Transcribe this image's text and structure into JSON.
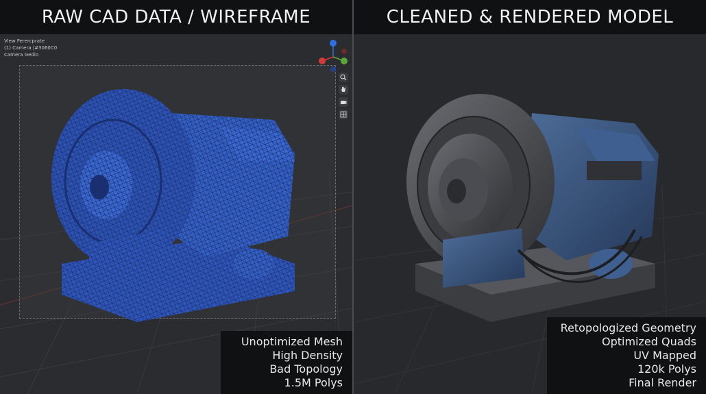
{
  "left_panel": {
    "title": "RAW CAD DATA / WIREFRAME",
    "viewport_info": [
      "View Ferercprate",
      "(1) Camera |#3060C0",
      "Camera Gedio"
    ],
    "caption": [
      "Unoptimized Mesh",
      "High Density",
      "Bad Topology",
      "1.5M Polys"
    ],
    "mesh_color": "#2f55b8",
    "gizmo_axes": {
      "z": "#2d6fe0",
      "x": "#d23a3a",
      "y": "#5aa83c"
    },
    "tools": [
      "zoom-icon",
      "hand-pan-icon",
      "camera-icon",
      "grid-view-icon"
    ]
  },
  "right_panel": {
    "title": "CLEANED & RENDERED MODEL",
    "caption": [
      "Retopologized Geometry",
      "Optimized Quads",
      "UV Mapped",
      "120k Polys",
      "Final Render"
    ],
    "body_color": "#3a5680",
    "metal_color": "#4a4c51"
  }
}
